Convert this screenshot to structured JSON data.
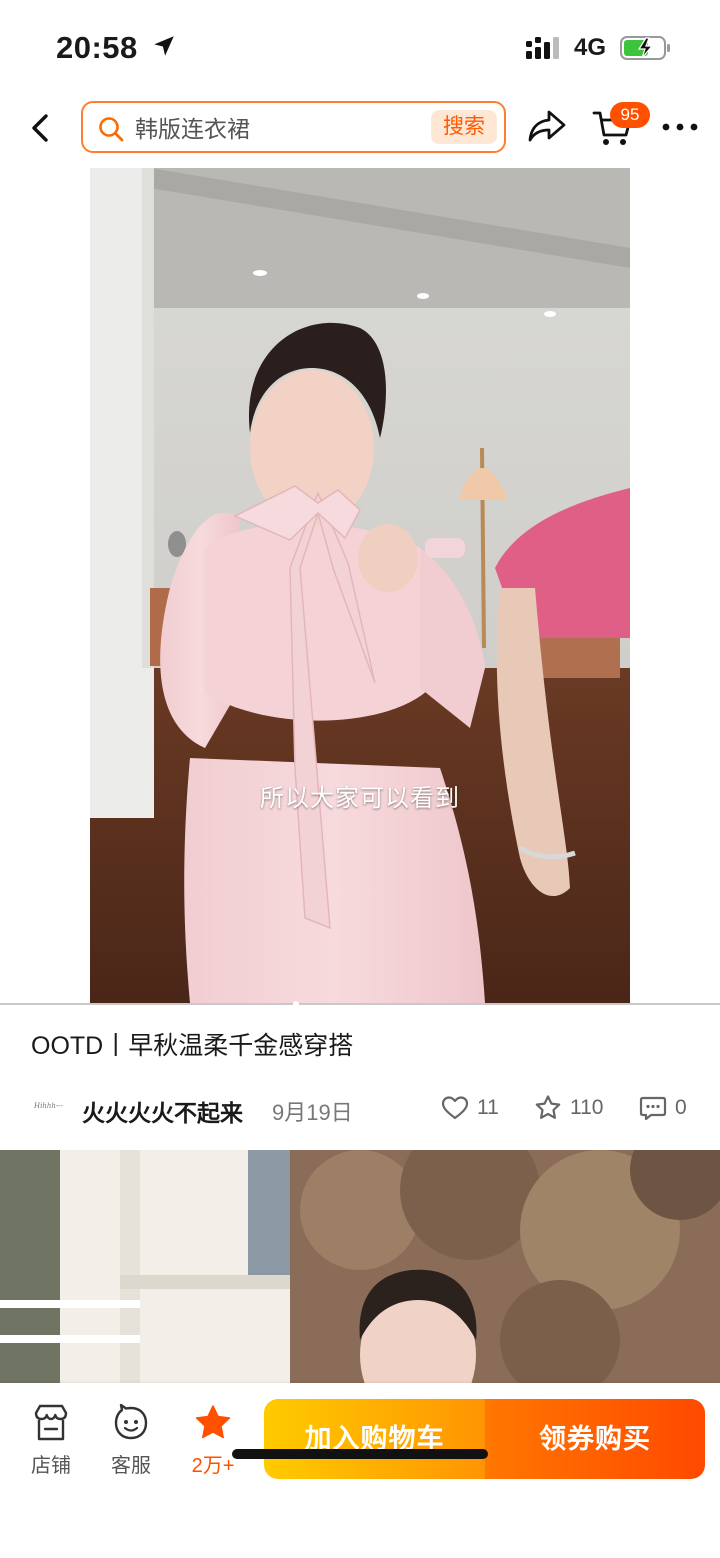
{
  "status_bar": {
    "time": "20:58",
    "network": "4G",
    "icons": [
      "location-arrow-icon",
      "signal-bars-icon",
      "battery-charging-icon"
    ]
  },
  "nav": {
    "search_value": "韩版连衣裙",
    "search_button": "搜索",
    "cart_badge": "95",
    "icons": [
      "back-icon",
      "search-icon",
      "share-icon",
      "cart-icon",
      "more-icon"
    ]
  },
  "video": {
    "caption": "所以大家可以看到"
  },
  "post": {
    "title": "OOTD丨早秋温柔千金感穿搭",
    "avatar_text": "Hihhh---",
    "author": "火火火火不起来",
    "date": "9月19日",
    "likes": "11",
    "favorites": "110",
    "comments": "0"
  },
  "bottom_bar": {
    "store_label": "店铺",
    "service_label": "客服",
    "favorite_label": "2万+",
    "add_to_cart": "加入购物车",
    "buy_with_coupon": "领券购买"
  },
  "colors": {
    "accent": "#ff5000",
    "search_border": "#ff7d2e",
    "cart_button_start": "#ffcb00",
    "buy_button_end": "#ff4900"
  }
}
